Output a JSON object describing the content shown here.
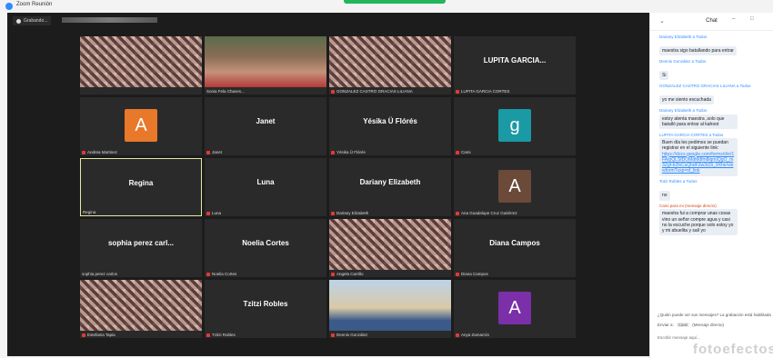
{
  "window": {
    "title": "Zoom Reunión",
    "recording": "Grabando..."
  },
  "tiles": [
    {
      "name": "",
      "label": "",
      "mic": false,
      "kind": "video-pixel"
    },
    {
      "name": "",
      "label": "Sonia Fela Chaves...",
      "mic": false,
      "kind": "video-woman"
    },
    {
      "name": "",
      "label": "GONZALEZ CASTRO GRACIAS LILIANA",
      "mic": true,
      "kind": "video-pixel"
    },
    {
      "name": "LUPITA GARCIA...",
      "label": "LUPITA GARCIA CORTES",
      "mic": true,
      "kind": "name"
    },
    {
      "name": "",
      "label": "Andrea Martinez",
      "mic": true,
      "kind": "avatar",
      "letter": "A",
      "color": "#e8782a"
    },
    {
      "name": "Janet",
      "label": "Janet",
      "mic": true,
      "kind": "name"
    },
    {
      "name": "Yésika Ü Flórés",
      "label": "Yésika Ü Flórés",
      "mic": true,
      "kind": "name"
    },
    {
      "name": "",
      "label": "Cami",
      "mic": true,
      "kind": "avatar",
      "letter": "g",
      "color": "#1a9aa5"
    },
    {
      "name": "Regina",
      "label": "Regina",
      "mic": false,
      "kind": "name",
      "active": true
    },
    {
      "name": "Luna",
      "label": "Luna",
      "mic": true,
      "kind": "name"
    },
    {
      "name": "Dariany Elizabeth",
      "label": "Dariany Elizabeth",
      "mic": true,
      "kind": "name"
    },
    {
      "name": "",
      "label": "Ana Guadalupe Cruz Gutiérrez",
      "mic": true,
      "kind": "avatar",
      "letter": "A",
      "color": "#6b4a3a"
    },
    {
      "name": "sophia perez carl...",
      "label": "sophia perez carlos",
      "mic": false,
      "kind": "name"
    },
    {
      "name": "Noelia Cortes",
      "label": "Noelia Cortes",
      "mic": true,
      "kind": "name"
    },
    {
      "name": "",
      "label": "Angela Carrillo",
      "mic": true,
      "kind": "video-pixel"
    },
    {
      "name": "Diana Campos",
      "label": "Diana Campos",
      "mic": true,
      "kind": "name"
    },
    {
      "name": "",
      "label": "Estefania Tapia",
      "mic": true,
      "kind": "video-pixel"
    },
    {
      "name": "Tzitzi Robles",
      "label": "Tzitzi Robles",
      "mic": true,
      "kind": "name"
    },
    {
      "name": "",
      "label": "Dennis González",
      "mic": true,
      "kind": "video-beach"
    },
    {
      "name": "",
      "label": "Anya Zamarrón",
      "mic": true,
      "kind": "avatar",
      "letter": "A",
      "color": "#7b2fa8"
    }
  ],
  "chat": {
    "title": "Chat",
    "messages": [
      {
        "from": "Dariany Elizabeth a Todos",
        "text": "maestra sigo batallando para entrar",
        "dm": false
      },
      {
        "from": "Dennis González a Todos",
        "text": "Si",
        "dm": false
      },
      {
        "from": "GONZALEZ CASTRO GRACIAS LILIANA a Todos",
        "text": "yo me siento escuchada",
        "dm": false
      },
      {
        "from": "Dariany Elizabeth a Todos",
        "text": "estoy atenta maestra ,solo que batalló para entrar al kahoot",
        "dm": false
      },
      {
        "from": "LUPITA GARCIA CORTES a Todos",
        "text": "Buen día les pedimos se puedan registrar en el siguiente link:",
        "link": "https://docs.google.com/forms/d/e/1FAIpQLSfDOMdMdfm8iqmIQgO_m3Zgf-b2fxCsQhdF2w3cDi_9Xhe/viewform?usp=sf_link",
        "dm": false
      },
      {
        "from": "Totzi Robles a Todos",
        "text": "no",
        "dm": false
      },
      {
        "from": "Cami para mi (mensaje directo)",
        "text": "maestra fui a comprar unas cosas vino un señor compre agua y casi no la escuche porque solo estoy yo y mi abuelita y salí yo",
        "dm": true
      }
    ],
    "notice": "¿Quién puede ver sus mensajes? La grabación está habilitada",
    "send_to_label": "Enviar a:",
    "send_to_value": "Cami",
    "send_mode": "(Mensaje directo)",
    "placeholder": "Escribir mensaje aquí..."
  },
  "watermark": "fotoefectos"
}
